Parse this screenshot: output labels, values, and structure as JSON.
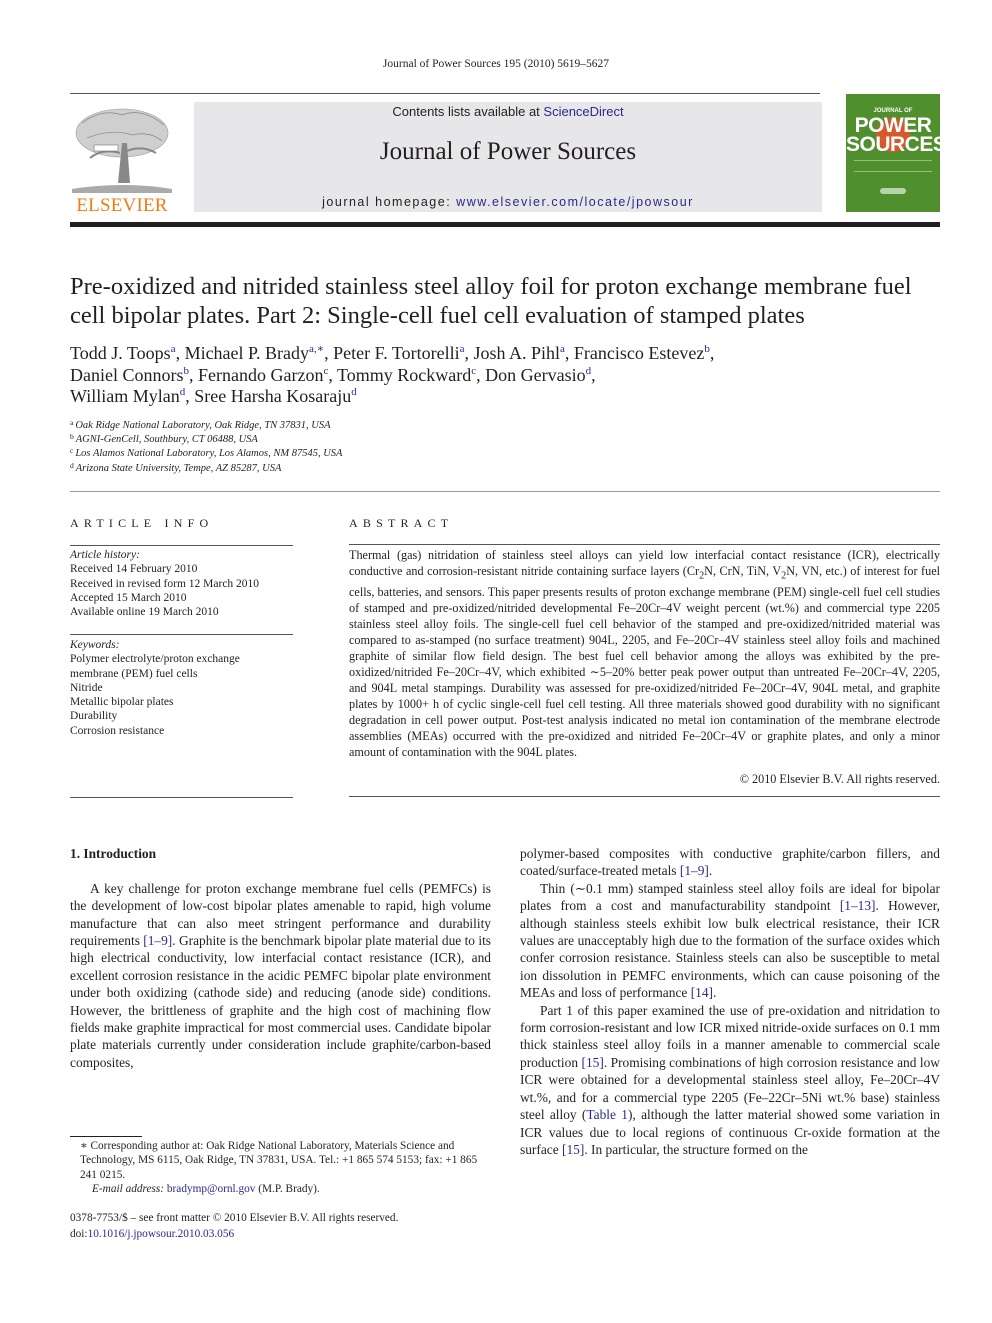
{
  "running_head": "Journal of Power Sources 195 (2010) 5619–5627",
  "header": {
    "publisher_logo_text": "ELSEVIER",
    "contents_prefix": "Contents lists available at ",
    "contents_link": "ScienceDirect",
    "journal_title": "Journal of Power Sources",
    "homepage_prefix": "journal homepage: ",
    "homepage_link": "www.elsevier.com/locate/jpowsour",
    "cover": {
      "small_text": "JOURNAL OF",
      "line1": "POWER",
      "line2": "SOURCES",
      "background_color": "#4f8f2e",
      "accent_color": "#d5592a"
    }
  },
  "colors": {
    "link": "#2a2a8c",
    "elsevier_orange": "#f07c13",
    "banner_gray": "#e7e7e9"
  },
  "article": {
    "title": "Pre-oxidized and nitrided stainless steel alloy foil for proton exchange membrane fuel cell bipolar plates. Part 2: Single-cell fuel cell evaluation of stamped plates",
    "authors": [
      {
        "name": "Todd J. Toops",
        "aff": "a",
        "sep": ", "
      },
      {
        "name": "Michael P. Brady",
        "aff": "a,∗",
        "sep": ", "
      },
      {
        "name": "Peter F. Tortorelli",
        "aff": "a",
        "sep": ", "
      },
      {
        "name": "Josh A. Pihl",
        "aff": "a",
        "sep": ", "
      },
      {
        "name": "Francisco Estevez",
        "aff": "b",
        "sep": ","
      },
      {
        "name": "Daniel Connors",
        "aff": "b",
        "sep": ", "
      },
      {
        "name": "Fernando Garzon",
        "aff": "c",
        "sep": ", "
      },
      {
        "name": "Tommy Rockward",
        "aff": "c",
        "sep": ", "
      },
      {
        "name": "Don Gervasio",
        "aff": "d",
        "sep": ","
      },
      {
        "name": "William Mylan",
        "aff": "d",
        "sep": ", "
      },
      {
        "name": "Sree Harsha Kosaraju",
        "aff": "d",
        "sep": ""
      }
    ],
    "affiliations": [
      {
        "key": "a",
        "text": "Oak Ridge National Laboratory, Oak Ridge, TN 37831, USA"
      },
      {
        "key": "b",
        "text": "AGNI-GenCell, Southbury, CT 06488, USA"
      },
      {
        "key": "c",
        "text": "Los Alamos National Laboratory, Los Alamos, NM 87545, USA"
      },
      {
        "key": "d",
        "text": "Arizona State University, Tempe, AZ 85287, USA"
      }
    ]
  },
  "article_info": {
    "heading": "ARTICLE INFO",
    "history_label": "Article history:",
    "history": [
      "Received 14 February 2010",
      "Received in revised form 12 March 2010",
      "Accepted 15 March 2010",
      "Available online 19 March 2010"
    ],
    "keywords_label": "Keywords:",
    "keywords": [
      "Polymer electrolyte/proton exchange membrane (PEM) fuel cells",
      "Nitride",
      "Metallic bipolar plates",
      "Durability",
      "Corrosion resistance"
    ]
  },
  "abstract": {
    "heading": "ABSTRACT",
    "part1": "Thermal (gas) nitridation of stainless steel alloys can yield low interfacial contact resistance (ICR), electrically conductive and corrosion-resistant nitride containing surface layers (Cr",
    "sub1": "2",
    "part2": "N, CrN, TiN, V",
    "sub2": "2",
    "part3": "N, VN, etc.) of interest for fuel cells, batteries, and sensors. This paper presents results of proton exchange membrane (PEM) single-cell fuel cell studies of stamped and pre-oxidized/nitrided developmental Fe–20Cr–4V weight percent (wt.%) and commercial type 2205 stainless steel alloy foils. The single-cell fuel cell behavior of the stamped and pre-oxidized/nitrided material was compared to as-stamped (no surface treatment) 904L, 2205, and Fe–20Cr–4V stainless steel alloy foils and machined graphite of similar flow field design. The best fuel cell behavior among the alloys was exhibited by the pre-oxidized/nitrided Fe–20Cr–4V, which exhibited ∼5–20% better peak power output than untreated Fe–20Cr–4V, 2205, and 904L metal stampings. Durability was assessed for pre-oxidized/nitrided Fe–20Cr–4V, 904L metal, and graphite plates by 1000+ h of cyclic single-cell fuel cell testing. All three materials showed good durability with no significant degradation in cell power output. Post-test analysis indicated no metal ion contamination of the membrane electrode assemblies (MEAs) occurred with the pre-oxidized and nitrided Fe–20Cr–4V or graphite plates, and only a minor amount of contamination with the 904L plates.",
    "copyright": "© 2010 Elsevier B.V. All rights reserved."
  },
  "body": {
    "section_heading": "1.  Introduction",
    "col1_p1_a": "A key challenge for proton exchange membrane fuel cells (PEMFCs) is the development of low-cost bipolar plates amenable to rapid, high volume manufacture that can also meet stringent performance and durability requirements ",
    "col1_p1_ref": "[1–9]",
    "col1_p1_b": ". Graphite is the benchmark bipolar plate material due to its high electrical conductivity, low interfacial contact resistance (ICR), and excellent corrosion resistance in the acidic PEMFC bipolar plate environment under both oxidizing (cathode side) and reducing (anode side) conditions. However, the brittleness of graphite and the high cost of machining flow fields make graphite impractical for most commercial uses. Candidate bipolar plate materials currently under consideration include graphite/carbon-based composites,",
    "col2_p1_a": "polymer-based composites with conductive graphite/carbon fillers, and coated/surface-treated metals ",
    "col2_p1_ref": "[1–9]",
    "col2_p1_b": ".",
    "col2_p2_a": "Thin (∼0.1 mm) stamped stainless steel alloy foils are ideal for bipolar plates from a cost and manufacturability standpoint ",
    "col2_p2_ref1": "[1–13]",
    "col2_p2_b": ". However, although stainless steels exhibit low bulk electrical resistance, their ICR values are unacceptably high due to the formation of the surface oxides which confer corrosion resistance. Stainless steels can also be susceptible to metal ion dissolution in PEMFC environments, which can cause poisoning of the MEAs and loss of performance ",
    "col2_p2_ref2": "[14]",
    "col2_p2_c": ".",
    "col2_p3_a": "Part 1 of this paper examined the use of pre-oxidation and nitridation to form corrosion-resistant and low ICR mixed nitride-oxide surfaces on 0.1 mm thick stainless steel alloy foils in a manner amenable to commercial scale production ",
    "col2_p3_ref1": "[15]",
    "col2_p3_b": ". Promising combinations of high corrosion resistance and low ICR were obtained for a developmental stainless steel alloy, Fe–20Cr–4V wt.%, and for a commercial type 2205 (Fe–22Cr–5Ni wt.% base) stainless steel alloy (",
    "col2_p3_ref2": "Table 1",
    "col2_p3_c": "), although the latter material showed some variation in ICR values due to local regions of continuous Cr-oxide formation at the surface ",
    "col2_p3_ref3": "[15]",
    "col2_p3_d": ". In particular, the structure formed on the"
  },
  "footnote": {
    "corresponding": "∗ Corresponding author at: Oak Ridge National Laboratory, Materials Science and Technology, MS 6115, Oak Ridge, TN 37831, USA. Tel.: +1 865 574 5153; fax: +1 865 241 0215.",
    "email_label": "E-mail address: ",
    "email": "bradymp@ornl.gov",
    "email_suffix": " (M.P. Brady).",
    "front_matter": "0378-7753/$ – see front matter © 2010 Elsevier B.V. All rights reserved.",
    "doi_prefix": "doi:",
    "doi": "10.1016/j.jpowsour.2010.03.056"
  }
}
